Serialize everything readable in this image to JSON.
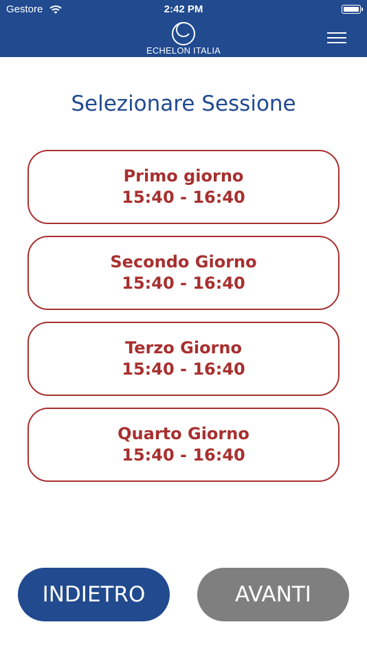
{
  "status_bar": {
    "carrier": "Gestore",
    "time": "2:42 PM"
  },
  "header": {
    "logo_text": "ECHELON ITALIA"
  },
  "page": {
    "title": "Selezionare Sessione"
  },
  "sessions": [
    {
      "day": "Primo giorno",
      "time": "15:40 - 16:40"
    },
    {
      "day": "Secondo Giorno",
      "time": "15:40 - 16:40"
    },
    {
      "day": "Terzo Giorno",
      "time": "15:40 - 16:40"
    },
    {
      "day": "Quarto Giorno",
      "time": "15:40 - 16:40"
    }
  ],
  "footer": {
    "back_label": "INDIETRO",
    "next_label": "AVANTI"
  },
  "colors": {
    "primary": "#214a8f",
    "accent": "#a7302f",
    "disabled": "#7f7f7f"
  }
}
